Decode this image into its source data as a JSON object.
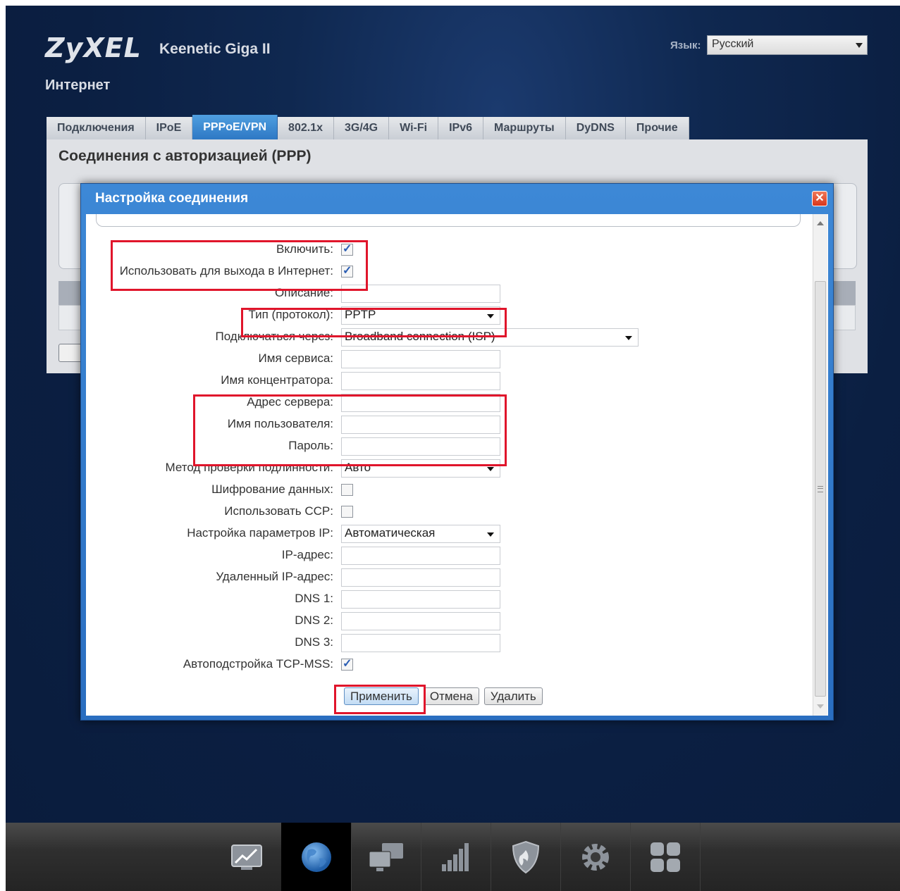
{
  "header": {
    "brand": "ZyXEL",
    "model": "Keenetic Giga II",
    "language_label": "Язык:",
    "language_value": "Русский",
    "section_title": "Интернет"
  },
  "tabs": [
    {
      "label": "Подключения",
      "active": false
    },
    {
      "label": "IPoE",
      "active": false
    },
    {
      "label": "PPPoE/VPN",
      "active": true
    },
    {
      "label": "802.1x",
      "active": false
    },
    {
      "label": "3G/4G",
      "active": false
    },
    {
      "label": "Wi-Fi",
      "active": false
    },
    {
      "label": "IPv6",
      "active": false
    },
    {
      "label": "Маршруты",
      "active": false
    },
    {
      "label": "DyDNS",
      "active": false
    },
    {
      "label": "Прочие",
      "active": false
    }
  ],
  "content": {
    "title": "Соединения с авторизацией (PPP)"
  },
  "dialog": {
    "title": "Настройка соединения",
    "close_icon": "close-icon",
    "fields": {
      "enable": {
        "label": "Включить:",
        "checked": true
      },
      "use_for_internet": {
        "label": "Использовать для выхода в Интернет:",
        "checked": true
      },
      "description": {
        "label": "Описание:",
        "value": ""
      },
      "protocol": {
        "label": "Тип (протокол):",
        "value": "PPTP"
      },
      "connect_via": {
        "label": "Подключаться через:",
        "value": "Broadband connection (ISP)"
      },
      "service_name": {
        "label": "Имя сервиса:",
        "value": ""
      },
      "concentrator_name": {
        "label": "Имя концентратора:",
        "value": ""
      },
      "server_address": {
        "label": "Адрес сервера:",
        "value": ""
      },
      "username": {
        "label": "Имя пользователя:",
        "value": ""
      },
      "password": {
        "label": "Пароль:",
        "value": ""
      },
      "auth_method": {
        "label": "Метод проверки подлинности:",
        "value": "Авто"
      },
      "encryption": {
        "label": "Шифрование данных:",
        "checked": false
      },
      "use_ccp": {
        "label": "Использовать CCP:",
        "checked": false
      },
      "ip_settings": {
        "label": "Настройка параметров IP:",
        "value": "Автоматическая"
      },
      "ip_address": {
        "label": "IP-адрес:",
        "value": ""
      },
      "remote_ip": {
        "label": "Удаленный IP-адрес:",
        "value": ""
      },
      "dns1": {
        "label": "DNS 1:",
        "value": ""
      },
      "dns2": {
        "label": "DNS 2:",
        "value": ""
      },
      "dns3": {
        "label": "DNS 3:",
        "value": ""
      },
      "tcp_mss": {
        "label": "Автоподстройка TCP-MSS:",
        "checked": true
      }
    },
    "buttons": {
      "apply": "Применить",
      "cancel": "Отмена",
      "delete": "Удалить"
    }
  },
  "bottom_nav": [
    {
      "icon": "monitor-chart-icon",
      "active": false
    },
    {
      "icon": "globe-icon",
      "active": true
    },
    {
      "icon": "network-computers-icon",
      "active": false
    },
    {
      "icon": "signal-bars-icon",
      "active": false
    },
    {
      "icon": "shield-icon",
      "active": false
    },
    {
      "icon": "gear-icon",
      "active": false
    },
    {
      "icon": "apps-grid-icon",
      "active": false
    }
  ],
  "colors": {
    "highlight": "#e0152b",
    "tab_active": "#2e78c4",
    "dialog_frame": "#2a6ec0",
    "page_bg": "#0f2850"
  }
}
